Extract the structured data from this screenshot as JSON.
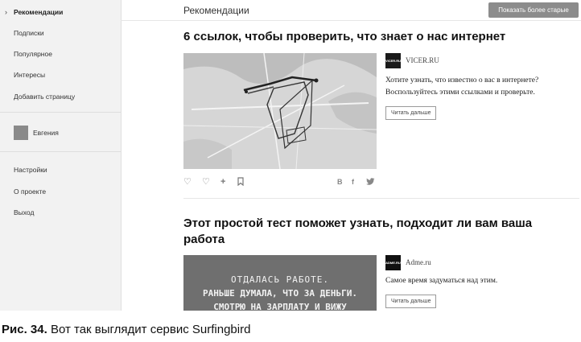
{
  "sidebar": {
    "items": [
      {
        "label": "Рекомендации",
        "active": true
      },
      {
        "label": "Подписки"
      },
      {
        "label": "Популярное"
      },
      {
        "label": "Интересы"
      },
      {
        "label": "Добавить страницу"
      }
    ],
    "user": {
      "name": "Евгения"
    },
    "bottom_items": [
      {
        "label": "Настройки"
      },
      {
        "label": "О проекте"
      },
      {
        "label": "Выход"
      }
    ]
  },
  "header": {
    "title": "Рекомендации",
    "show_older_label": "Показать более старые"
  },
  "articles": [
    {
      "title": "6 ссылок, чтобы проверить, что знает о нас интернет",
      "source_logo": "VICER.RU",
      "source": "VICER.RU",
      "description": "Хотите узнать, что известно о вас в интернете? Воспользуйтесь этими ссылками и проверьте.",
      "read_more": "Читать дальше",
      "share": [
        "В",
        "f"
      ]
    },
    {
      "title": "Этот простой тест поможет узнать, подходит ли вам ваша работа",
      "source_logo": "ADME.RU",
      "source": "Adme.ru",
      "description": "Самое время задуматься над этим.",
      "read_more": "Читать дальше",
      "poster_lines": [
        "ОТДАЛАСЬ РАБОТЕ.",
        "РАНЬШЕ ДУМАЛА, ЧТО ЗА ДЕНЬГИ.",
        "СМОТРЮ НА ЗАРПЛАТУ И ВИЖУ"
      ]
    }
  ],
  "caption": {
    "label": "Рис. 34.",
    "text": "Вот так выглядит сервис Surfingbird"
  },
  "colors": {
    "sidebar_bg": "#f2f2f2",
    "button_bg": "#8c8c8c"
  }
}
